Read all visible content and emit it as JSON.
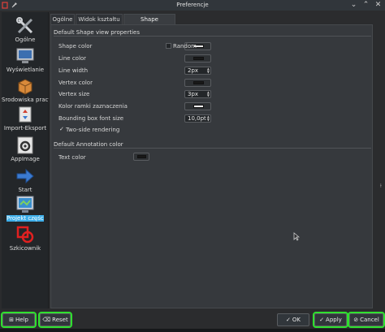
{
  "window": {
    "title": "Preferencje"
  },
  "sidebar": {
    "items": [
      {
        "label": "Ogólne",
        "icon": "tools-icon"
      },
      {
        "label": "Wyświetlanie",
        "icon": "monitor-icon"
      },
      {
        "label": "Środowiska pracy",
        "icon": "workbench-icon"
      },
      {
        "label": "Import-Eksport",
        "icon": "import-export-icon"
      },
      {
        "label": "AppImage",
        "icon": "appimage-gear-icon"
      },
      {
        "label": "Start",
        "icon": "start-arrow-icon"
      },
      {
        "label": "Projekt części",
        "icon": "part-design-icon"
      },
      {
        "label": "Szkicownik",
        "icon": "sketcher-icon"
      }
    ],
    "active_index": 6
  },
  "tabs": [
    {
      "label": "Ogólne"
    },
    {
      "label": "Widok kształtu"
    },
    {
      "label": "Shape appearance"
    }
  ],
  "active_tab": 2,
  "shape_group": {
    "title": "Default Shape view properties",
    "shape_color": {
      "label": "Shape color",
      "color": "#e6e6e6"
    },
    "random": {
      "label": "Random",
      "checked": false
    },
    "line_color": {
      "label": "Line color",
      "color": "#191919"
    },
    "line_width": {
      "label": "Line width",
      "value": "2px"
    },
    "vertex_color": {
      "label": "Vertex color",
      "color": "#191919"
    },
    "vertex_size": {
      "label": "Vertex size",
      "value": "3px"
    },
    "selection_frame_color": {
      "label": "Kolor ramki zaznaczenia",
      "color": "#ffffff"
    },
    "bbox_font_size": {
      "label": "Bounding box font size",
      "value": "10,0pt"
    },
    "two_side": {
      "label": "Two-side rendering",
      "checked": true
    }
  },
  "annotation_group": {
    "title": "Default Annotation color",
    "text_color": {
      "label": "Text color",
      "color": "#191919"
    }
  },
  "buttons": {
    "help": "Help",
    "reset": "Reset",
    "ok": "OK",
    "apply": "Apply",
    "cancel": "Cancel"
  },
  "colors": {
    "highlight": "#2fe02f",
    "accent": "#3daee9"
  }
}
